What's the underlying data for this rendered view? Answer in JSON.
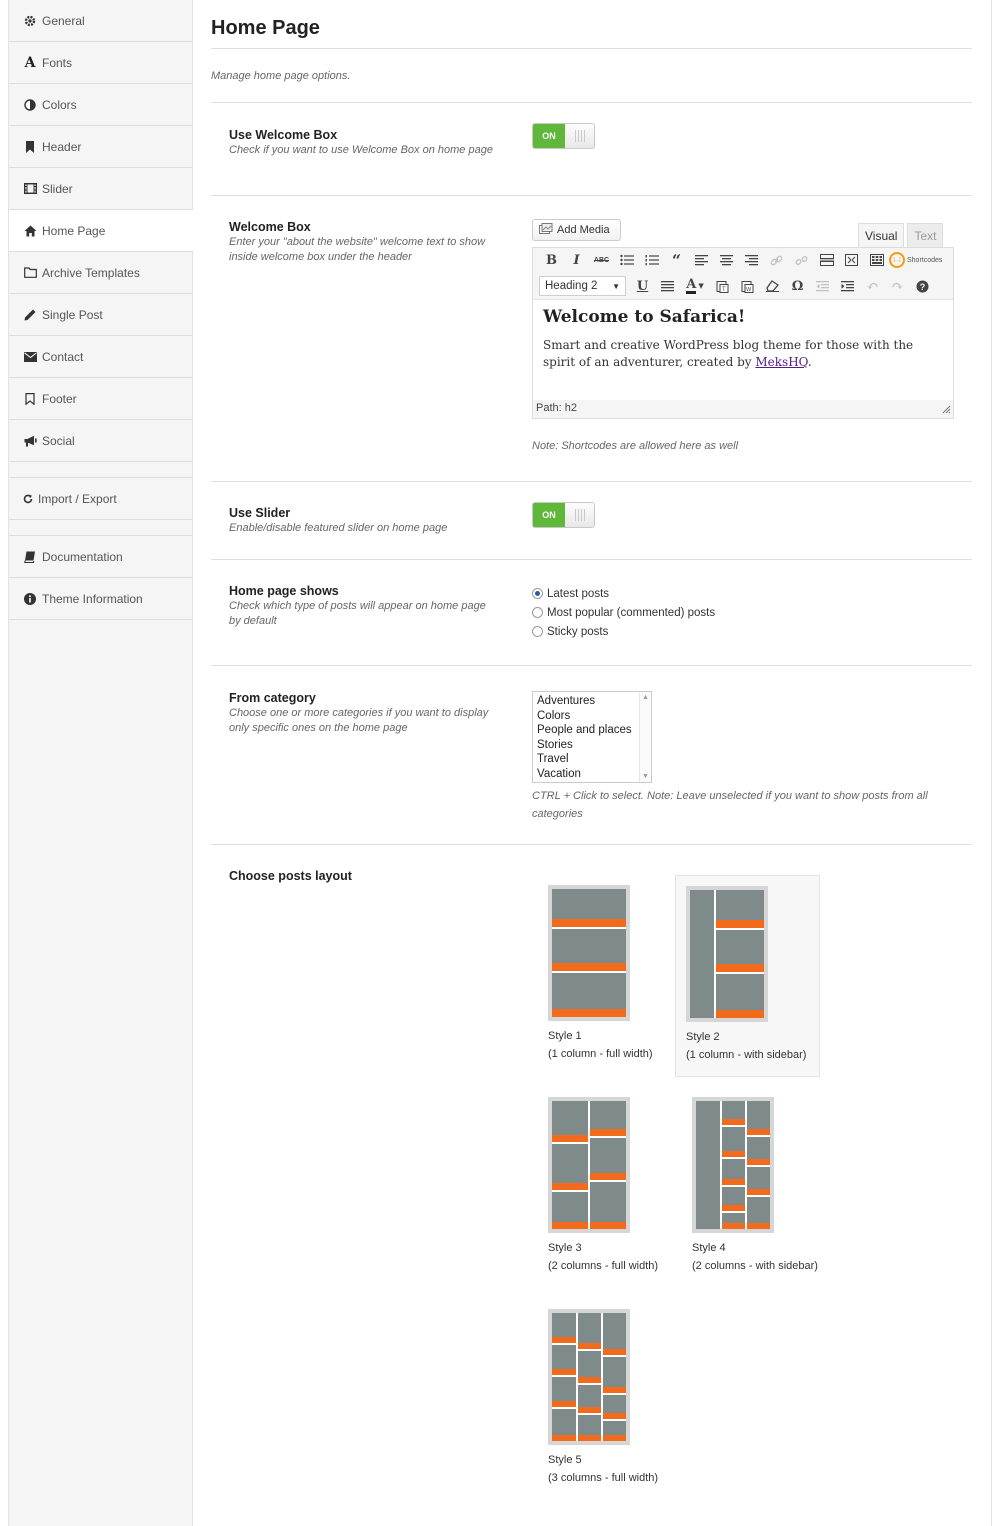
{
  "sidebar": {
    "items": [
      {
        "label": "General",
        "icon": "gear-icon"
      },
      {
        "label": "Fonts",
        "icon": "font-icon"
      },
      {
        "label": "Colors",
        "icon": "contrast-icon"
      },
      {
        "label": "Header",
        "icon": "bookmark-icon"
      },
      {
        "label": "Slider",
        "icon": "film-icon"
      },
      {
        "label": "Home Page",
        "icon": "home-icon"
      },
      {
        "label": "Archive Templates",
        "icon": "folder-icon"
      },
      {
        "label": "Single Post",
        "icon": "pencil-icon"
      },
      {
        "label": "Contact",
        "icon": "envelope-icon"
      },
      {
        "label": "Footer",
        "icon": "bookmark-outline-icon"
      },
      {
        "label": "Social",
        "icon": "megaphone-icon"
      },
      {
        "label": "Import / Export",
        "icon": "refresh-icon"
      },
      {
        "label": "Documentation",
        "icon": "book-icon"
      },
      {
        "label": "Theme Information",
        "icon": "info-icon"
      }
    ]
  },
  "page": {
    "title": "Home Page",
    "intro": "Manage home page options."
  },
  "welcome_toggle": {
    "label": "Use Welcome Box",
    "desc": "Check if you want to use Welcome Box on home page",
    "state": "ON"
  },
  "welcome_box": {
    "label": "Welcome Box",
    "desc": "Enter your \"about the website\" welcome text to show inside welcome box under the header",
    "add_media": "Add Media",
    "tab_visual": "Visual",
    "tab_text": "Text",
    "format": "Heading 2",
    "shortcodes_label": "Shortcodes",
    "heading": "Welcome to Safarica!",
    "body_text": "Smart and creative WordPress blog theme for those with the spirit of an adventurer, created by",
    "link_text": "MeksHQ",
    "body_end": ".",
    "path": "Path: h2",
    "note": "Note: Shortcodes are allowed here as well"
  },
  "slider_toggle": {
    "label": "Use Slider",
    "desc": "Enable/disable featured slider on home page",
    "state": "ON"
  },
  "home_shows": {
    "label": "Home page shows",
    "desc": "Check which type of posts will appear on home page by default",
    "options": [
      "Latest posts",
      "Most popular (commented) posts",
      "Sticky posts"
    ],
    "selected": "Latest posts"
  },
  "from_category": {
    "label": "From category",
    "desc": "Choose one or more categories if you want to display only specific ones on the home page",
    "options": [
      "Adventures",
      "Colors",
      "People and places",
      "Stories",
      "Travel",
      "Vacation"
    ],
    "help": "CTRL + Click to select. Note: Leave unselected if you want to show posts from all categories"
  },
  "layout": {
    "label": "Choose posts layout",
    "styles": [
      {
        "name": "Style 1",
        "desc": "(1 column - full width)"
      },
      {
        "name": "Style 2",
        "desc": "(1 column - with sidebar)"
      },
      {
        "name": "Style 3",
        "desc": "(2 columns - full width)"
      },
      {
        "name": "Style 4",
        "desc": "(2 columns - with sidebar)"
      },
      {
        "name": "Style 5",
        "desc": "(3 columns - full width)"
      }
    ],
    "selected": "Style 2"
  },
  "colors": {
    "toggle_on": "#5fb83a",
    "thumb_gray": "#7f8a8a",
    "thumb_orange": "#f26a1b",
    "link": "#551a8b"
  }
}
